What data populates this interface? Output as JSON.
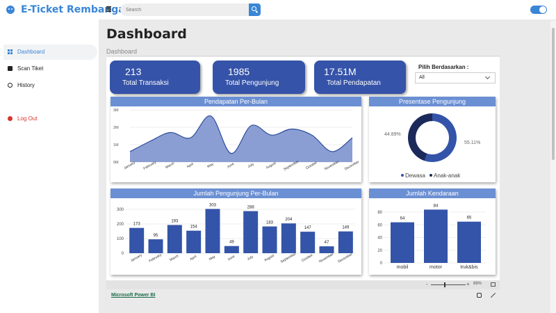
{
  "app": {
    "title": "E-Ticket Rembangan"
  },
  "search": {
    "placeholder": "Search"
  },
  "sidebar": {
    "items": [
      {
        "label": "Dashboard",
        "icon": "dashboard-icon",
        "active": true
      },
      {
        "label": "Scan Tiket",
        "icon": "scan-icon"
      },
      {
        "label": "History",
        "icon": "history-icon"
      },
      {
        "label": "Log Out",
        "icon": "logout-icon"
      }
    ]
  },
  "page": {
    "title": "Dashboard",
    "breadcrumb": "Dashboard"
  },
  "kpis": [
    {
      "value": "213",
      "label": "Total Transaksi"
    },
    {
      "value": "1985",
      "label": "Total Pengunjung"
    },
    {
      "value": "17.51M",
      "label": "Total Pendapatan"
    }
  ],
  "filter": {
    "label": "Pilih Berdasarkan :",
    "value": "All"
  },
  "colors": {
    "accent": "#3a86d6",
    "kpi": "#3553a8",
    "panel_header": "#6b8fd3",
    "bar": "#3354a8",
    "area": "#8a9ed3",
    "donut_dark": "#1b2a5a",
    "danger": "#d9342b"
  },
  "footer": {
    "zoom": "88%",
    "link": "Microsoft Power BI"
  },
  "chart_data": [
    {
      "type": "area",
      "title": "Pendapatan Per-Bulan",
      "categories": [
        "January",
        "February",
        "March",
        "April",
        "May",
        "June",
        "July",
        "August",
        "September",
        "October",
        "November",
        "December"
      ],
      "values": [
        0.6,
        1.2,
        1.7,
        1.4,
        2.65,
        0.5,
        2.1,
        1.55,
        1.9,
        1.55,
        0.6,
        1.4
      ],
      "y_ticks": [
        "0M",
        "1M",
        "2M",
        "3M"
      ],
      "ylim": [
        0,
        3
      ],
      "grid": true
    },
    {
      "type": "pie",
      "title": "Presentase Pengunjung",
      "series": [
        {
          "name": "Dewasa",
          "value": 55.11,
          "label": "55.11%"
        },
        {
          "name": "Anak-anak",
          "value": 44.89,
          "label": "44.89%"
        }
      ],
      "legend": "bottom"
    },
    {
      "type": "bar",
      "title": "Jumlah Pengunjung Per-Bulan",
      "categories": [
        "January",
        "February",
        "March",
        "April",
        "May",
        "June",
        "July",
        "August",
        "September",
        "October",
        "November",
        "December"
      ],
      "values": [
        173,
        95,
        193,
        154,
        303,
        49,
        288,
        183,
        204,
        147,
        47,
        149
      ],
      "y_ticks": [
        "0",
        "100",
        "200",
        "300"
      ],
      "ylim": [
        0,
        300
      ],
      "grid": true
    },
    {
      "type": "bar",
      "title": "Jumlah Kendaraan",
      "categories": [
        "mobil",
        "motor",
        "truk&bis"
      ],
      "values": [
        64,
        84,
        65
      ],
      "y_ticks": [
        "0",
        "20",
        "40",
        "60",
        "80"
      ],
      "ylim": [
        0,
        80
      ],
      "grid": true
    }
  ]
}
